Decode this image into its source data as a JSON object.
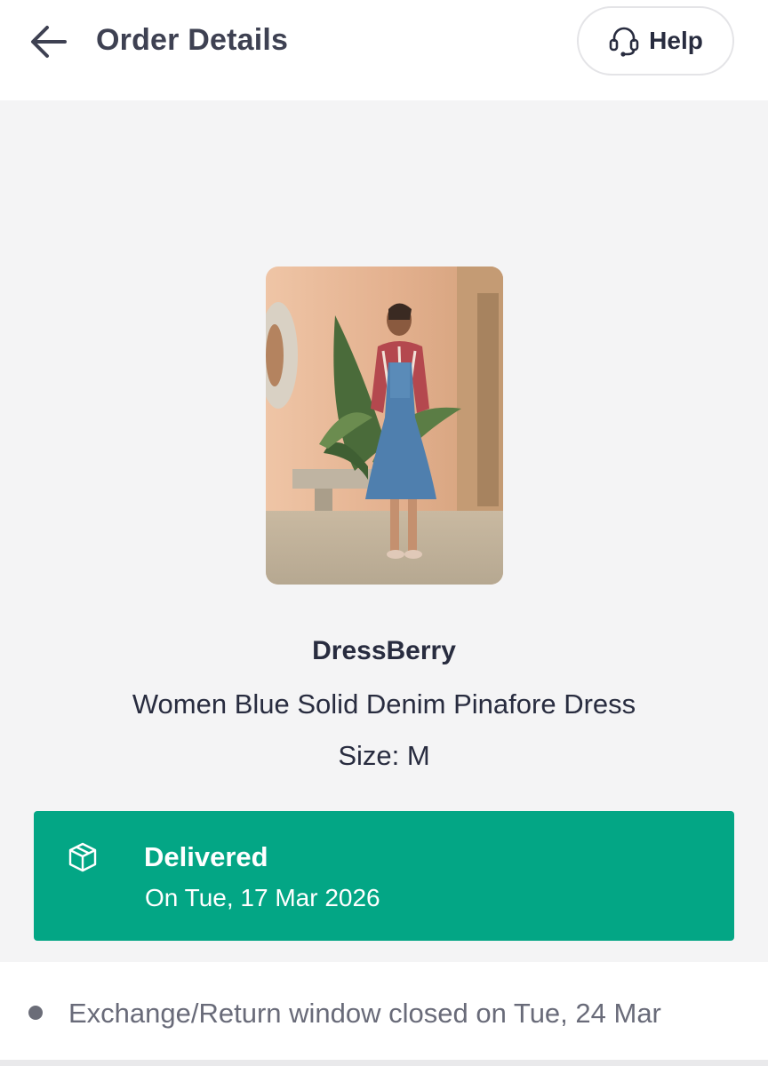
{
  "header": {
    "title": "Order Details",
    "back_icon": "arrow-left-icon",
    "help": {
      "label": "Help",
      "icon": "headset-icon"
    }
  },
  "product": {
    "brand": "DressBerry",
    "name": "Women Blue Solid Denim Pinafore Dress",
    "size_label": "Size: M"
  },
  "status": {
    "icon": "package-box-icon",
    "title": "Delivered",
    "date": "On Tue, 17 Mar 2026",
    "color": "#03a685"
  },
  "info": {
    "text": "Exchange/Return window closed on Tue, 24 Mar"
  },
  "colors": {
    "header_bg": "#ffffff",
    "page_bg": "#f4f4f5",
    "text_primary": "#282c3f",
    "text_muted": "#696b79"
  }
}
